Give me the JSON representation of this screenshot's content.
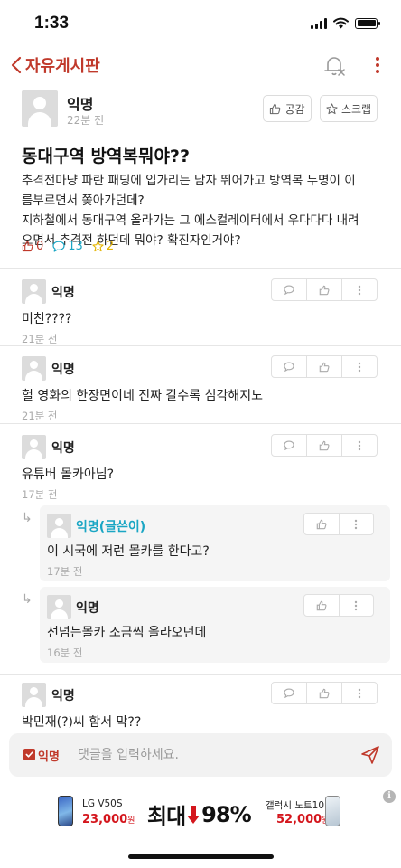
{
  "status": {
    "time": "1:33"
  },
  "nav": {
    "title": "자유게시판",
    "icons": [
      "back-chevron-icon",
      "bell-off-icon",
      "more-vertical-icon"
    ]
  },
  "post": {
    "author": "익명",
    "time": "22분 전",
    "like_label": "공감",
    "scrap_label": "스크랩",
    "title": "동대구역 방역복뭐야??",
    "body_lines": [
      "추격전마냥 파란 패딩에 입가리는 남자 뛰어가고 방역복 두명이 이",
      "름부르면서 쫒아가던데?",
      "지하철에서 동대구역 올라가는 그 에스컬레이터에서 우다다다 내려",
      "오면서 추격전 하던데 뭐야? 확진자인거야?"
    ],
    "stats": {
      "likes": "0",
      "comments": "13",
      "scraps": "2"
    },
    "colors": {
      "accent": "#c0392b",
      "comment_blue": "#1aa6c4",
      "scrap_yellow": "#e4b400"
    }
  },
  "comments": [
    {
      "author": "익명",
      "text": "미친????",
      "time": "21분 전"
    },
    {
      "author": "익명",
      "text": "헐 영화의 한장면이네 진짜 갈수록 심각해지노",
      "time": "21분 전"
    },
    {
      "author": "익명",
      "text": "유튜버 몰카아님?",
      "time": "17분 전"
    },
    {
      "author": "익명(글쓴이)",
      "text": "이 시국에 저런 몰카를 한다고?",
      "time": "17분 전",
      "reply": true
    },
    {
      "author": "익명",
      "text": "선넘는몰카 조금씩 올라오던데",
      "time": "16분 전",
      "reply": true
    },
    {
      "author": "익명",
      "text": "박민재(?)씨 함서 막??"
    }
  ],
  "input": {
    "anon_label": "익명",
    "placeholder": "댓글을 입력하세요."
  },
  "ad": {
    "left_name": "LG V50S",
    "left_price": "23,000",
    "won": "원",
    "headline_pre": "최대",
    "headline_post": "98%",
    "right_name": "갤럭시 노트10",
    "right_price": "52,000",
    "info": "i"
  }
}
